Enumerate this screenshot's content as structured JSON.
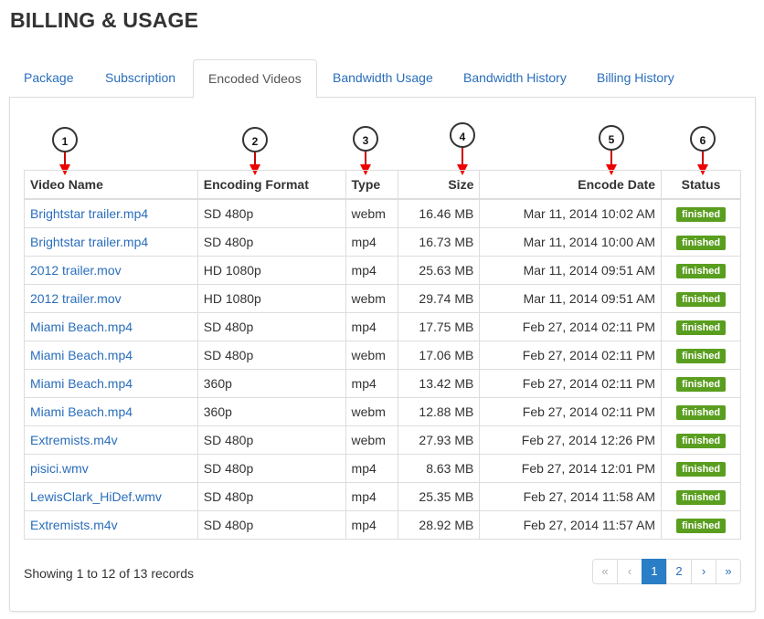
{
  "page": {
    "title": "BILLING & USAGE"
  },
  "tabs": [
    {
      "label": "Package"
    },
    {
      "label": "Subscription"
    },
    {
      "label": "Encoded Videos",
      "active": true
    },
    {
      "label": "Bandwidth Usage"
    },
    {
      "label": "Bandwidth History"
    },
    {
      "label": "Billing History"
    }
  ],
  "callouts": [
    "1",
    "2",
    "3",
    "4",
    "5",
    "6"
  ],
  "table": {
    "headers": [
      "Video Name",
      "Encoding Format",
      "Type",
      "Size",
      "Encode Date",
      "Status"
    ],
    "rows": [
      [
        "Brightstar trailer.mp4",
        "SD 480p",
        "webm",
        "16.46 MB",
        "Mar 11, 2014 10:02 AM",
        "finished"
      ],
      [
        "Brightstar trailer.mp4",
        "SD 480p",
        "mp4",
        "16.73 MB",
        "Mar 11, 2014 10:00 AM",
        "finished"
      ],
      [
        "2012 trailer.mov",
        "HD 1080p",
        "mp4",
        "25.63 MB",
        "Mar 11, 2014 09:51 AM",
        "finished"
      ],
      [
        "2012 trailer.mov",
        "HD 1080p",
        "webm",
        "29.74 MB",
        "Mar 11, 2014 09:51 AM",
        "finished"
      ],
      [
        "Miami Beach.mp4",
        "SD 480p",
        "mp4",
        "17.75 MB",
        "Feb 27, 2014 02:11 PM",
        "finished"
      ],
      [
        "Miami Beach.mp4",
        "SD 480p",
        "webm",
        "17.06 MB",
        "Feb 27, 2014 02:11 PM",
        "finished"
      ],
      [
        "Miami Beach.mp4",
        "360p",
        "mp4",
        "13.42 MB",
        "Feb 27, 2014 02:11 PM",
        "finished"
      ],
      [
        "Miami Beach.mp4",
        "360p",
        "webm",
        "12.88 MB",
        "Feb 27, 2014 02:11 PM",
        "finished"
      ],
      [
        "Extremists.m4v",
        "SD 480p",
        "webm",
        "27.93 MB",
        "Feb 27, 2014 12:26 PM",
        "finished"
      ],
      [
        "pisici.wmv",
        "SD 480p",
        "mp4",
        "8.63 MB",
        "Feb 27, 2014 12:01 PM",
        "finished"
      ],
      [
        "LewisClark_HiDef.wmv",
        "SD 480p",
        "mp4",
        "25.35 MB",
        "Feb 27, 2014 11:58 AM",
        "finished"
      ],
      [
        "Extremists.m4v",
        "SD 480p",
        "mp4",
        "28.92 MB",
        "Feb 27, 2014 11:57 AM",
        "finished"
      ]
    ]
  },
  "footer": {
    "records": "Showing 1 to 12 of 13 records"
  },
  "pagination": {
    "first": "«",
    "prev": "‹",
    "pages": [
      "1",
      "2"
    ],
    "current": "1",
    "next": "›",
    "last": "»"
  },
  "colors": {
    "link": "#2a6ebb",
    "badge": "#5a9e1f",
    "active_page": "#2a7ec5",
    "arrow": "#e00000"
  }
}
